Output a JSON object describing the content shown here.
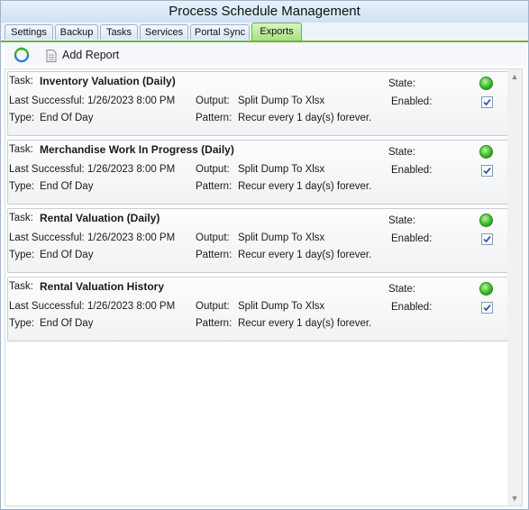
{
  "window": {
    "title": "Process Schedule Management"
  },
  "tabs": [
    {
      "label": "Settings"
    },
    {
      "label": "Backup"
    },
    {
      "label": "Tasks"
    },
    {
      "label": "Services"
    },
    {
      "label": "Portal Sync"
    },
    {
      "label": "Exports",
      "active": true
    }
  ],
  "toolbar": {
    "refresh_icon": "refresh-icon",
    "add_report_label": "Add Report",
    "add_report_icon": "document-icon"
  },
  "labels": {
    "task": "Task:",
    "last_successful": "Last Successful:",
    "type": "Type:",
    "output": "Output:",
    "pattern": "Pattern:",
    "state": "State:",
    "enabled": "Enabled:"
  },
  "colors": {
    "active_tab": "#a9e07d",
    "state_ok": "#33b421",
    "check": "#2a5db0"
  },
  "reports": [
    {
      "name": "Inventory Valuation (Daily)",
      "last_successful": "1/26/2023 8:00 PM",
      "type": "End Of Day",
      "output": "Split Dump To Xlsx",
      "pattern": "Recur every 1 day(s) forever.",
      "state": "ok",
      "enabled": true
    },
    {
      "name": "Merchandise Work In Progress (Daily)",
      "last_successful": "1/26/2023 8:00 PM",
      "type": "End Of Day",
      "output": "Split Dump To Xlsx",
      "pattern": "Recur every 1 day(s) forever.",
      "state": "ok",
      "enabled": true
    },
    {
      "name": "Rental Valuation (Daily)",
      "last_successful": "1/26/2023 8:00 PM",
      "type": "End Of Day",
      "output": "Split Dump To Xlsx",
      "pattern": "Recur every 1 day(s) forever.",
      "state": "ok",
      "enabled": true
    },
    {
      "name": "Rental Valuation History",
      "last_successful": "1/26/2023 8:00 PM",
      "type": "End Of Day",
      "output": "Split Dump To Xlsx",
      "pattern": "Recur every 1 day(s) forever.",
      "state": "ok",
      "enabled": true
    }
  ]
}
